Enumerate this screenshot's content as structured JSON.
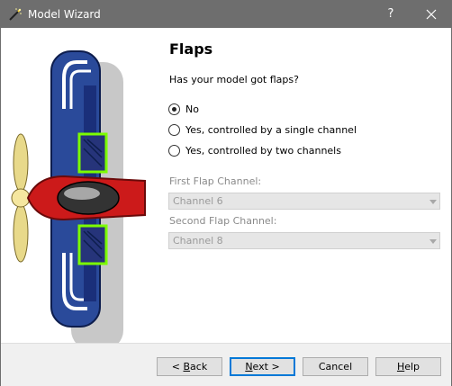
{
  "window": {
    "title": "Model Wizard",
    "help_label": "?"
  },
  "page": {
    "title": "Flaps",
    "question": "Has your model got flaps?"
  },
  "options": [
    {
      "label": "No",
      "checked": true
    },
    {
      "label": "Yes, controlled by a single channel",
      "checked": false
    },
    {
      "label": "Yes, controlled by two channels",
      "checked": false
    }
  ],
  "fields": {
    "first_flap": {
      "label": "First Flap Channel:",
      "value": "Channel 6",
      "enabled": false
    },
    "second_flap": {
      "label": "Second Flap Channel:",
      "value": "Channel 8",
      "enabled": false
    }
  },
  "buttons": {
    "back": {
      "mnemonic": "B",
      "rest": "ack",
      "prefix": "< "
    },
    "next": {
      "mnemonic": "N",
      "rest": "ext",
      "suffix": " >"
    },
    "cancel": {
      "label": "Cancel"
    },
    "help": {
      "mnemonic": "H",
      "rest": "elp"
    }
  },
  "colors": {
    "titlebar": "#6e6e6e",
    "wing_blue": "#2a4a9a",
    "fuselage_red": "#cc1a1a",
    "flap_green": "#7cfc00",
    "propeller": "#e8d98a"
  }
}
